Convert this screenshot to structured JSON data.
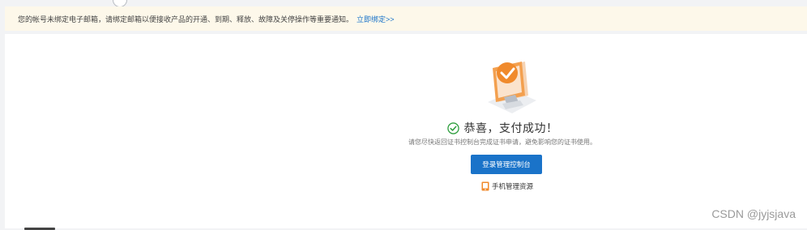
{
  "notice": {
    "text": "您的帐号未绑定电子邮箱，请绑定邮箱以便接收产品的开通、到期、释放、故障及关停操作等重要通知。",
    "link": "立即绑定>>"
  },
  "result": {
    "title": "恭喜，支付成功！",
    "subtitle": "请您尽快返回证书控制台完成证书申请，避免影响您的证书使用。",
    "primary_button": "登录管理控制台",
    "mobile_link": "手机管理资源"
  },
  "watermark": "CSDN @jyjsjava",
  "colors": {
    "accent": "#1a73c9",
    "success": "#2e9e3e",
    "notice_bg": "#fdf8ea",
    "illustration": "#f08a2c"
  },
  "icons": [
    "success-check-icon",
    "monitor-illustration",
    "mobile-icon"
  ]
}
